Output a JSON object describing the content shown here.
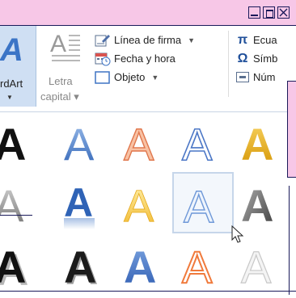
{
  "window": {
    "controls": [
      "minimize",
      "maximize",
      "close"
    ]
  },
  "ribbon": {
    "wordart": {
      "label": "rdArt",
      "icon": "wordart-a-icon"
    },
    "drop_cap": {
      "line1": "Letra",
      "line2": "capital",
      "icon": "drop-cap-icon"
    },
    "items": [
      {
        "label": "Línea de firma",
        "icon": "signature-line-icon",
        "has_dropdown": true
      },
      {
        "label": "Fecha y hora",
        "icon": "date-time-icon",
        "has_dropdown": false
      },
      {
        "label": "Objeto",
        "icon": "object-icon",
        "has_dropdown": true
      }
    ],
    "symbols": [
      {
        "label": "Ecua",
        "glyph": "π",
        "icon": "equation-icon"
      },
      {
        "label": "Símb",
        "glyph": "Ω",
        "icon": "symbol-icon"
      },
      {
        "label": "Núm",
        "glyph": "",
        "icon": "number-icon"
      }
    ]
  },
  "gallery": {
    "letter": "A",
    "selected_style": 8,
    "styles": [
      "black-fill",
      "blue-gradient",
      "orange-outline",
      "blue-outline",
      "gold-fill",
      "gray-gradient",
      "blue-reflection",
      "gold-gradient",
      "light-blue-outline",
      "dark-gray-gradient",
      "black-shadow",
      "black-bevel",
      "blue-bevel",
      "orange-outline-fill",
      "silver-outline"
    ],
    "colors": {
      "black": "#111111",
      "blue": "#3f74c4",
      "orange": "#f4a07a",
      "light_blue_outline": "#4c77c6",
      "gold": "#f1b72b",
      "gray": "#8c8c8c",
      "silver": "#cccccc"
    }
  }
}
